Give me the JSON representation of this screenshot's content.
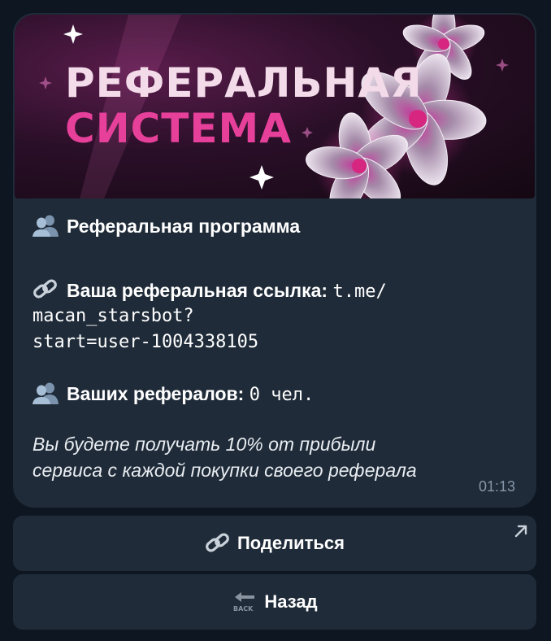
{
  "banner": {
    "line1": "РЕФЕРАЛЬНАЯ",
    "line2": "СИСТЕМА"
  },
  "message": {
    "heading": "Реферальная программа",
    "link_label": "Ваша реферальная ссылка:",
    "link_part1": "t.me/",
    "link_part2": "macan_starsbot?",
    "link_part3": "start=user-1004338105",
    "referrals_label": "Ваших рефералов:",
    "referrals_count": "0 чел.",
    "info_line1": "Вы будете получать 10% от прибыли",
    "info_line2": "сервиса с каждой покупки своего реферала",
    "time": "01:13"
  },
  "keyboard": {
    "share_label": "Поделиться",
    "back_label": "Назад",
    "back_icon_text": "BACK"
  },
  "colors": {
    "background": "#0e1621",
    "bubble": "#1f2b38",
    "accent_pink": "#e7409a",
    "muted": "#8796a8"
  },
  "icons": {
    "people": "busts-in-silhouette-icon",
    "link": "link-icon",
    "back": "back-arrow-icon",
    "external": "arrow-up-right-icon"
  }
}
